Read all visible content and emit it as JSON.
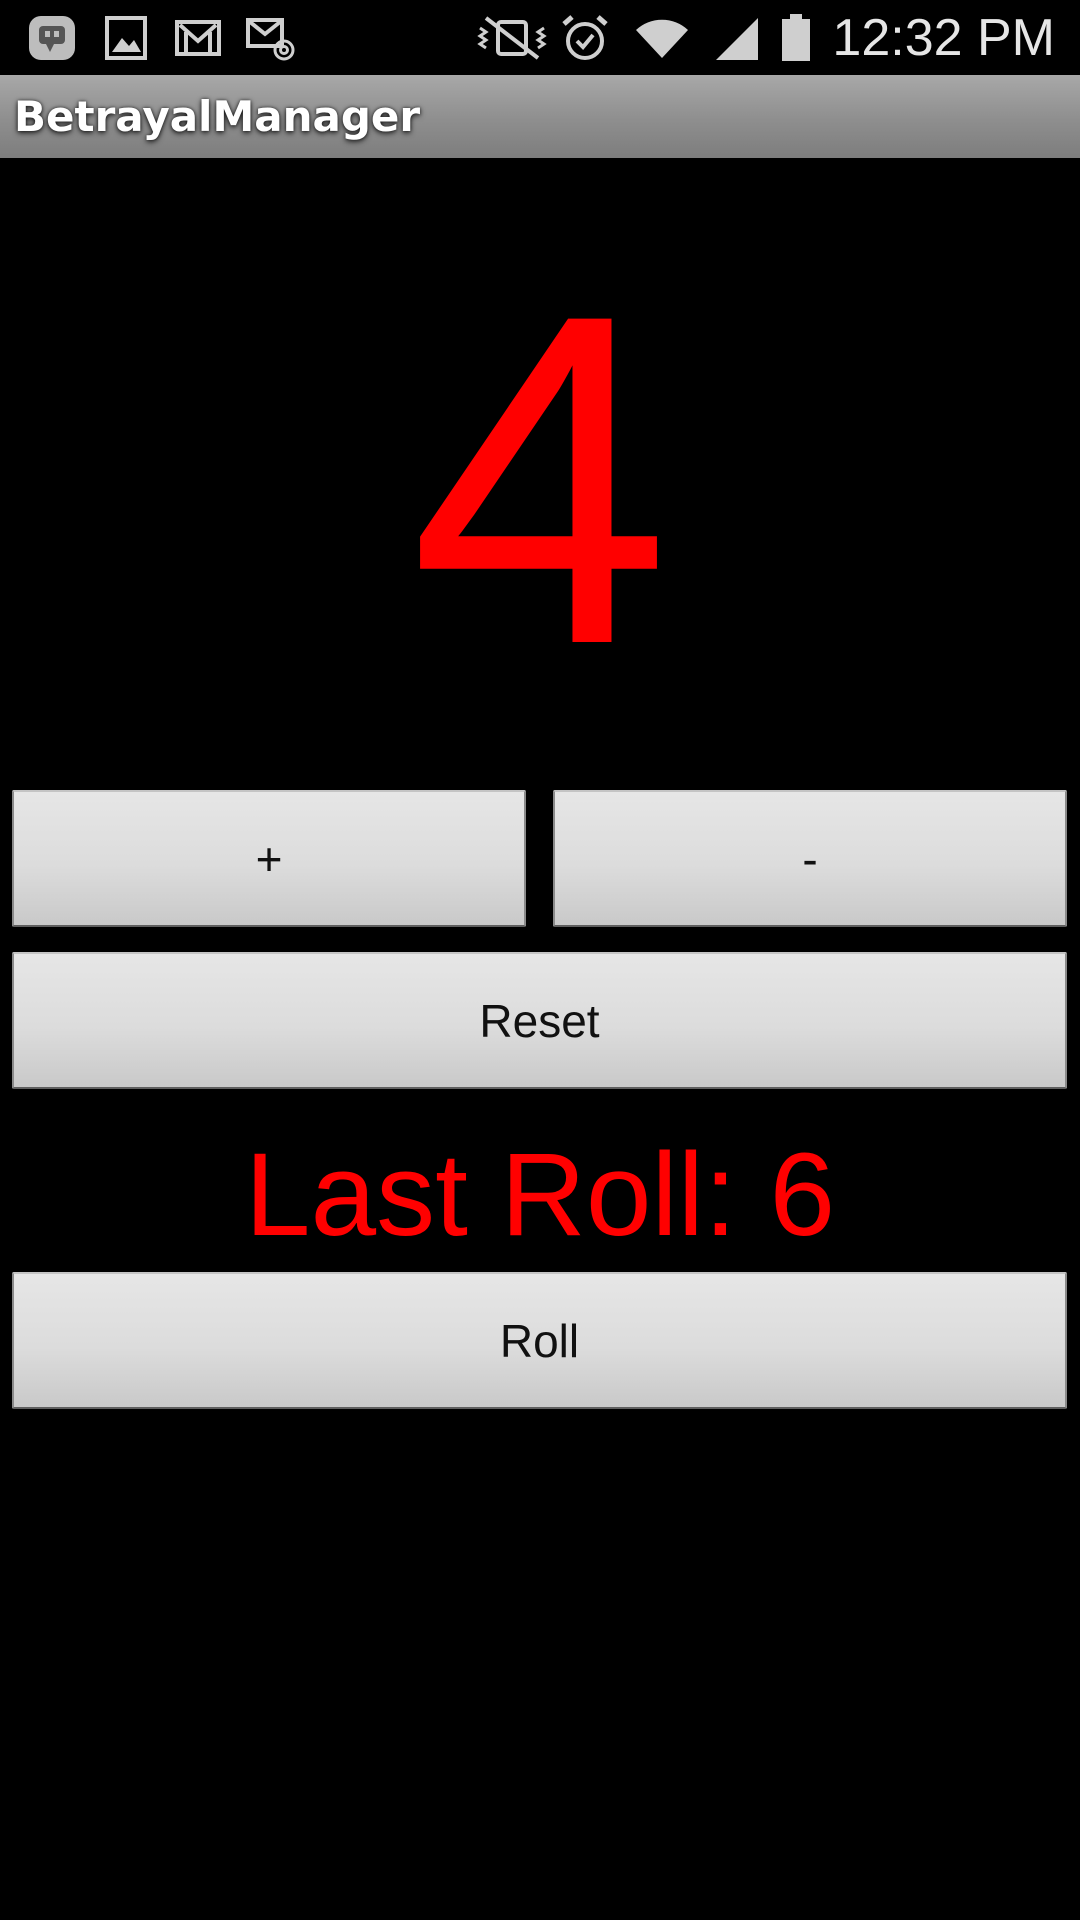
{
  "status_bar": {
    "time": "12:32 PM",
    "icons": [
      "hangouts-icon",
      "gallery-icon",
      "gmail-icon",
      "email-icon",
      "mute-vibrate-icon",
      "alarm-icon",
      "wifi-icon",
      "signal-icon",
      "battery-icon"
    ]
  },
  "action_bar": {
    "title": "BetrayalManager"
  },
  "main": {
    "counter_value": "4",
    "plus_label": "+",
    "minus_label": "-",
    "reset_label": "Reset",
    "last_roll_text": "Last Roll: 6",
    "roll_label": "Roll"
  },
  "colors": {
    "accent_red": "#ff0000",
    "background": "#000000",
    "action_bar": "#8e8e8e"
  }
}
